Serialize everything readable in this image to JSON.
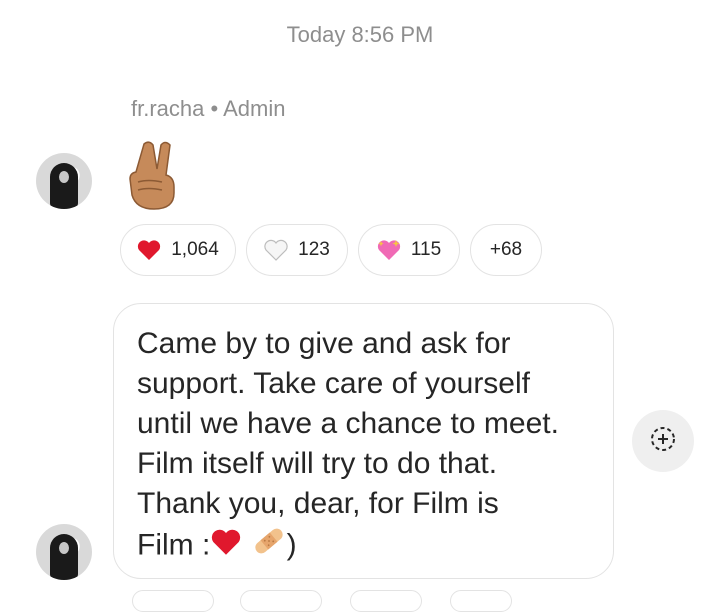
{
  "thread": {
    "timestamp": "Today 8:56 PM",
    "sender": "fr.racha • Admin"
  },
  "messages": [
    {
      "type": "emoji",
      "emoji_name": "victory-hand-medium-skin-tone",
      "reactions": [
        {
          "icon": "red-heart-icon",
          "count": "1,064"
        },
        {
          "icon": "white-heart-icon",
          "count": "123"
        },
        {
          "icon": "sparkling-heart-icon",
          "count": "115"
        },
        {
          "icon": "",
          "count": "+68"
        }
      ]
    },
    {
      "type": "text",
      "lines": [
        "Came by to give and ask for",
        "support. Take care of yourself",
        "until we have a chance to meet.",
        "Film itself will try to do that.",
        "Thank you, dear, for Film is"
      ],
      "last_line_prefix": "Film :",
      "last_line_suffix": ")",
      "inline_emojis": [
        "red-heart-icon",
        "adhesive-bandage-icon"
      ]
    }
  ],
  "colors": {
    "meta_text": "#8e8e8e",
    "text": "#262626",
    "border": "#e3e3e3",
    "heart_red": "#e0182d"
  }
}
